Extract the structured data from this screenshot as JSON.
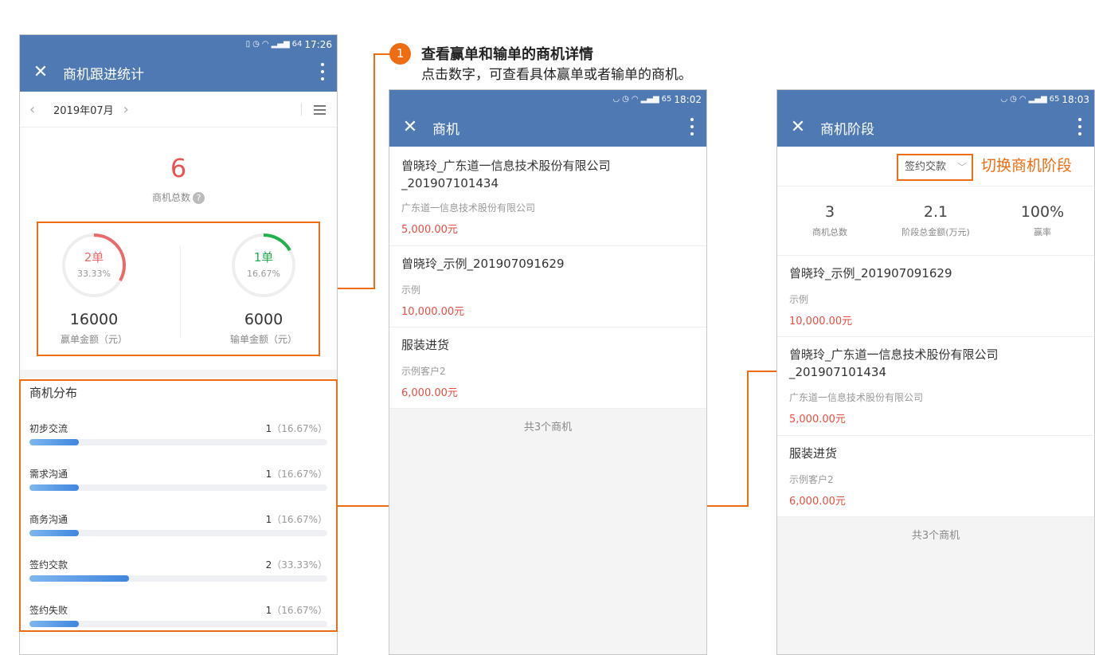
{
  "callout": {
    "number": "1",
    "title": "查看赢单和输单的商机详情",
    "description": "点击数字，可查看具体赢单或者输单的商机。",
    "switch_label": "切换商机阶段"
  },
  "colors": {
    "header": "#4f79b3",
    "accent": "#ee6c12",
    "won": "#e86a6a",
    "lost": "#22b14c",
    "amount": "#e84e40"
  },
  "phone1": {
    "status": {
      "time": "17:26",
      "battery": "64"
    },
    "title": "商机跟进统计",
    "month": "2019年07月",
    "total": {
      "value": "6",
      "label": "商机总数",
      "help": "?"
    },
    "won": {
      "count": "2单",
      "percent": "33.33%",
      "fraction": 0.3333,
      "amount": "16000",
      "amount_label": "赢单金额（元）"
    },
    "lost": {
      "count": "1单",
      "percent": "16.67%",
      "fraction": 0.1667,
      "amount": "6000",
      "amount_label": "输单金额（元）"
    },
    "distribution": {
      "title": "商机分布",
      "rows": [
        {
          "name": "初步交流",
          "count": "1",
          "pct": "（16.67%）",
          "fraction": 0.1667
        },
        {
          "name": "需求沟通",
          "count": "1",
          "pct": "（16.67%）",
          "fraction": 0.1667
        },
        {
          "name": "商务沟通",
          "count": "1",
          "pct": "（16.67%）",
          "fraction": 0.1667
        },
        {
          "name": "签约交款",
          "count": "2",
          "pct": "（33.33%）",
          "fraction": 0.3333
        },
        {
          "name": "签约失败",
          "count": "1",
          "pct": "（16.67%）",
          "fraction": 0.1667
        }
      ]
    }
  },
  "phone2": {
    "status": {
      "time": "18:02",
      "battery": "65"
    },
    "title": "商机",
    "deals": [
      {
        "name": "曾晓玲_广东道一信息技术股份有限公司_201907101434",
        "customer": "广东道一信息技术股份有限公司",
        "amount": "5,000.00元"
      },
      {
        "name": "曾晓玲_示例_201907091629",
        "customer": "示例",
        "amount": "10,000.00元"
      },
      {
        "name": "服装进货",
        "customer": "示例客户2",
        "amount": "6,000.00元"
      }
    ],
    "footer": "共3个商机"
  },
  "phone3": {
    "status": {
      "time": "18:03",
      "battery": "65"
    },
    "title": "商机阶段",
    "stage": "签约交款",
    "stats": [
      {
        "value": "3",
        "label": "商机总数"
      },
      {
        "value": "2.1",
        "label": "阶段总金额(万元)"
      },
      {
        "value": "100%",
        "label": "赢率"
      }
    ],
    "deals": [
      {
        "name": "曾晓玲_示例_201907091629",
        "customer": "示例",
        "amount": "10,000.00元"
      },
      {
        "name": "曾晓玲_广东道一信息技术股份有限公司_201907101434",
        "customer": "广东道一信息技术股份有限公司",
        "amount": "5,000.00元"
      },
      {
        "name": "服装进货",
        "customer": "示例客户2",
        "amount": "6,000.00元"
      }
    ],
    "footer": "共3个商机"
  }
}
